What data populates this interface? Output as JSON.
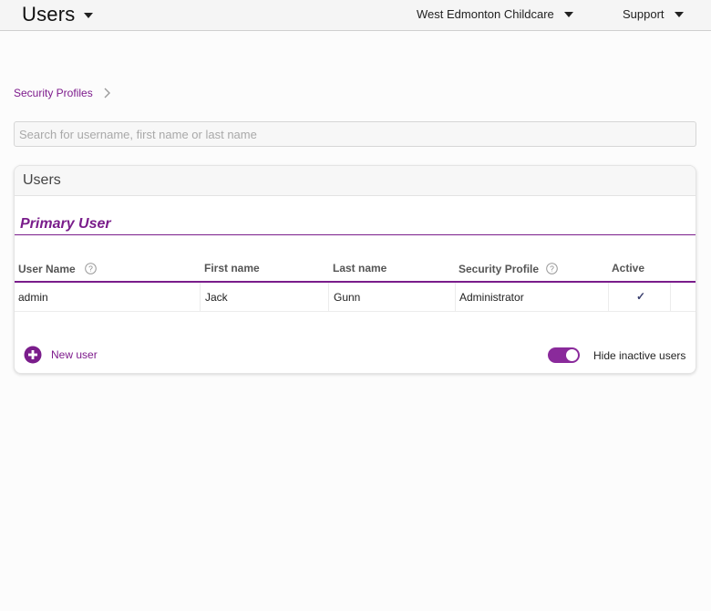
{
  "header": {
    "title": "Users",
    "location_menu": "West Edmonton Childcare",
    "support_menu": "Support"
  },
  "breadcrumb": {
    "link": "Security Profiles"
  },
  "search": {
    "placeholder": "Search for username, first name or last name",
    "value": ""
  },
  "card": {
    "title": "Users",
    "section_title": "Primary User",
    "columns": {
      "username": "User Name",
      "first_name": "First name",
      "last_name": "Last name",
      "security_profile": "Security Profile",
      "active": "Active"
    },
    "rows": [
      {
        "username": "admin",
        "first_name": "Jack",
        "last_name": "Gunn",
        "security_profile": "Administrator",
        "active": "✓"
      }
    ],
    "new_user_label": "New user",
    "hide_inactive_label": "Hide inactive users",
    "hide_inactive_on": true
  },
  "icons": {
    "help": "help-circle-icon",
    "chevron": "chevron-right-icon",
    "add": "plus-circle-icon"
  },
  "colors": {
    "accent": "#7a1d8b",
    "check": "#3a3f6e"
  }
}
